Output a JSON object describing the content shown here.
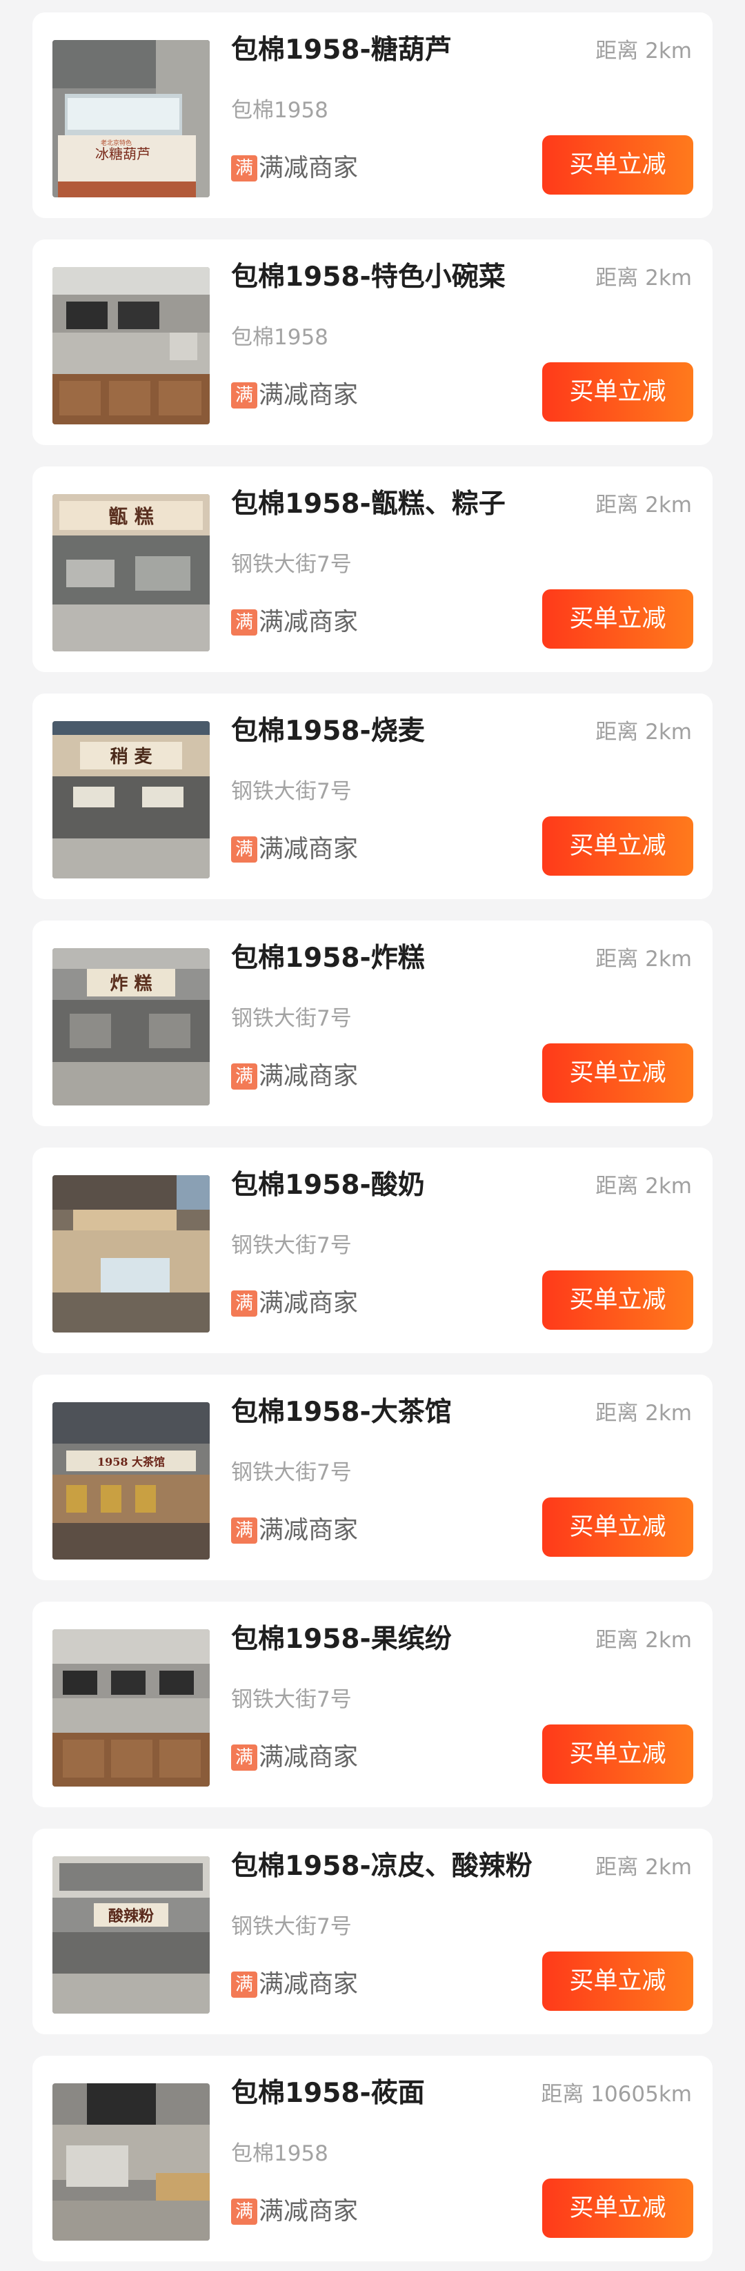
{
  "merchants": [
    {
      "name": "包棉1958-糖葫芦",
      "address": "包棉1958",
      "distance": "距离 2km",
      "promo_badge": "满",
      "promo_text": "满减商家",
      "button": "买单立减",
      "photo": "candied-haws-stall"
    },
    {
      "name": "包棉1958-特色小碗菜",
      "address": "包棉1958",
      "distance": "距离 2km",
      "promo_badge": "满",
      "promo_text": "满减商家",
      "button": "买单立减",
      "photo": "small-bowl-dishes-counter"
    },
    {
      "name": "包棉1958-甑糕、粽子",
      "address": "钢铁大街7号",
      "distance": "距离 2km",
      "promo_badge": "满",
      "promo_text": "满减商家",
      "button": "买单立减",
      "photo": "zenggao-stall",
      "sign_text": "甑    糕"
    },
    {
      "name": "包棉1958-烧麦",
      "address": "钢铁大街7号",
      "distance": "距离 2km",
      "promo_badge": "满",
      "promo_text": "满减商家",
      "button": "买单立减",
      "photo": "shaomai-stall",
      "sign_text": "稍    麦"
    },
    {
      "name": "包棉1958-炸糕",
      "address": "钢铁大街7号",
      "distance": "距离 2km",
      "promo_badge": "满",
      "promo_text": "满减商家",
      "button": "买单立减",
      "photo": "fried-cake-stall",
      "sign_text": "炸    糕"
    },
    {
      "name": "包棉1958-酸奶",
      "address": "钢铁大街7号",
      "distance": "距离 2km",
      "promo_badge": "满",
      "promo_text": "满减商家",
      "button": "买单立减",
      "photo": "yogurt-stall"
    },
    {
      "name": "包棉1958-大茶馆",
      "address": "钢铁大街7号",
      "distance": "距离 2km",
      "promo_badge": "满",
      "promo_text": "满减商家",
      "button": "买单立减",
      "photo": "teahouse-stall",
      "sign_text": "1958  大茶馆"
    },
    {
      "name": "包棉1958-果缤纷",
      "address": "钢铁大街7号",
      "distance": "距离 2km",
      "promo_badge": "满",
      "promo_text": "满减商家",
      "button": "买单立减",
      "photo": "fruit-stall"
    },
    {
      "name": "包棉1958-凉皮、酸辣粉",
      "address": "钢铁大街7号",
      "distance": "距离 2km",
      "promo_badge": "满",
      "promo_text": "满减商家",
      "button": "买单立减",
      "photo": "liangpi-stall",
      "sign_text": "酸辣粉"
    },
    {
      "name": "包棉1958-莜面",
      "address": "包棉1958",
      "distance": "距离 10605km",
      "promo_badge": "满",
      "promo_text": "满减商家",
      "button": "买单立减",
      "photo": "youmian-stall"
    }
  ],
  "colors": {
    "page_background": "#f4f4f5",
    "card_background": "#ffffff",
    "button_gradient_start": "#ff3a1a",
    "button_gradient_end": "#ff7a1c",
    "promo_badge": "#f37a55",
    "title_text": "#1f1f1f",
    "secondary_text": "#a0a0a0"
  }
}
